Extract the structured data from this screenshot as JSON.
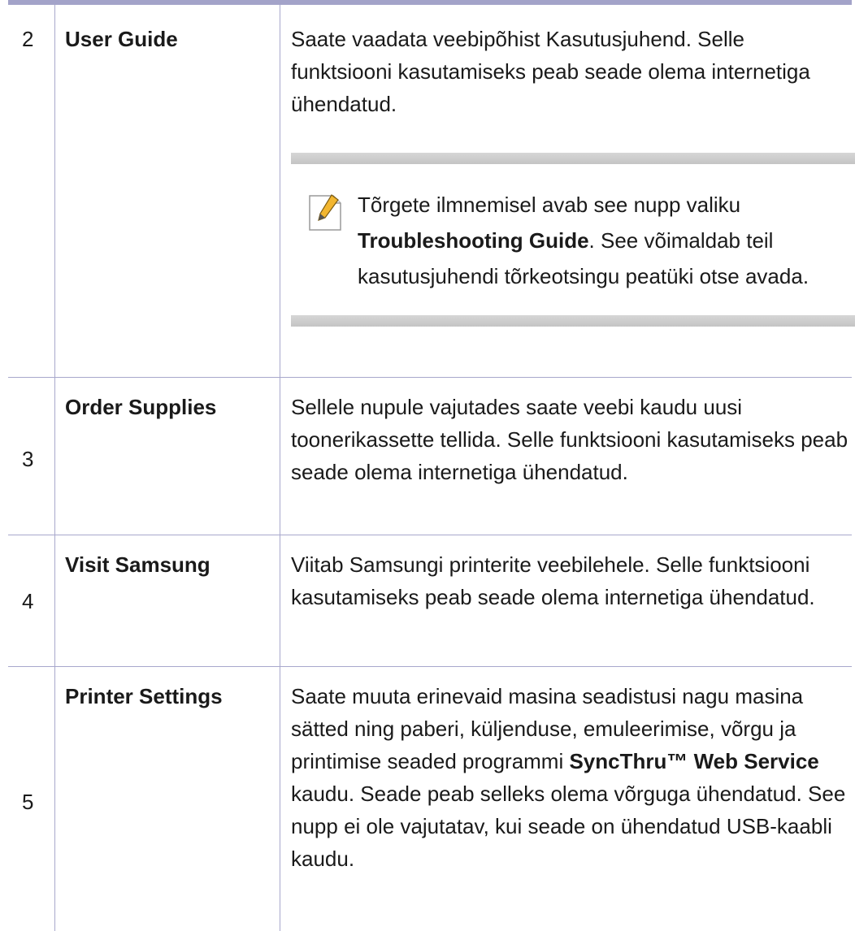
{
  "rows": [
    {
      "num": "2",
      "name": "User Guide",
      "desc": "Saate vaadata veebipõhist Kasutusjuhend. Selle funktsiooni kasutamiseks peab seade olema internetiga ühendatud.",
      "note": {
        "icon": "note-pencil-icon",
        "pre": "Tõrgete ilmnemisel avab see nupp valiku ",
        "bold": "Troubleshooting Guide",
        "post": ". See võimaldab teil kasutusjuhendi tõrkeotsingu peatüki otse avada."
      }
    },
    {
      "num": "3",
      "name": "Order Supplies",
      "desc": "Sellele nupule vajutades saate veebi kaudu uusi toonerikassette tellida. Selle funktsiooni kasutamiseks peab seade olema internetiga ühendatud."
    },
    {
      "num": "4",
      "name": "Visit Samsung",
      "desc": "Viitab Samsungi printerite veebilehele. Selle funktsiooni kasutamiseks peab seade olema internetiga ühendatud."
    },
    {
      "num": "5",
      "name": "Printer Settings",
      "desc_pre": "Saate muuta erinevaid masina seadistusi nagu masina sätted ning paberi, küljenduse, emuleerimise, võrgu ja printimise seaded programmi ",
      "desc_bold": "SyncThru™ Web Service",
      "desc_post": " kaudu. Seade peab selleks olema võrguga ühendatud. See nupp ei ole vajutatav, kui seade on ühendatud USB-kaabli kaudu."
    }
  ],
  "colors": {
    "rule": "#a8a8cc",
    "topbar": "#a3a3c9",
    "note_bar": "#cccccc"
  }
}
